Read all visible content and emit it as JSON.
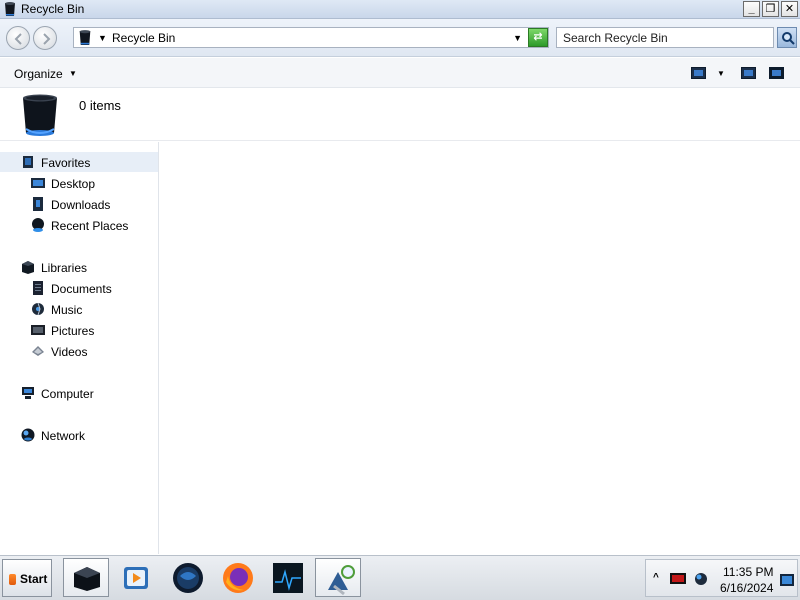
{
  "window": {
    "title": "Recycle Bin",
    "controls": {
      "minimize": "_",
      "maximize": "❐",
      "close": "✕"
    }
  },
  "address": {
    "location": "Recycle Bin",
    "search_placeholder": "Search Recycle Bin"
  },
  "commandbar": {
    "organize_label": "Organize"
  },
  "details": {
    "item_count": "0 items"
  },
  "navpane": {
    "favorites": {
      "label": "Favorites",
      "items": [
        {
          "label": "Desktop",
          "icon": "desktop-icon"
        },
        {
          "label": "Downloads",
          "icon": "downloads-icon"
        },
        {
          "label": "Recent Places",
          "icon": "recent-places-icon"
        }
      ]
    },
    "libraries": {
      "label": "Libraries",
      "items": [
        {
          "label": "Documents",
          "icon": "documents-icon"
        },
        {
          "label": "Music",
          "icon": "music-icon"
        },
        {
          "label": "Pictures",
          "icon": "pictures-icon"
        },
        {
          "label": "Videos",
          "icon": "videos-icon"
        }
      ]
    },
    "computer": {
      "label": "Computer"
    },
    "network": {
      "label": "Network"
    }
  },
  "taskbar": {
    "start_label": "Start",
    "apps": [
      "explorer-icon",
      "media-player-icon",
      "globe-icon",
      "firefox-icon",
      "monitor-icon",
      "settings-icon"
    ],
    "clock": {
      "time": "11:35 PM",
      "date": "6/16/2024"
    }
  },
  "colors": {
    "accent": "#3a7ac8",
    "title_bar": "#c9d7ea",
    "refresh": "#2d9a2a",
    "selected": "#e7eef7"
  }
}
